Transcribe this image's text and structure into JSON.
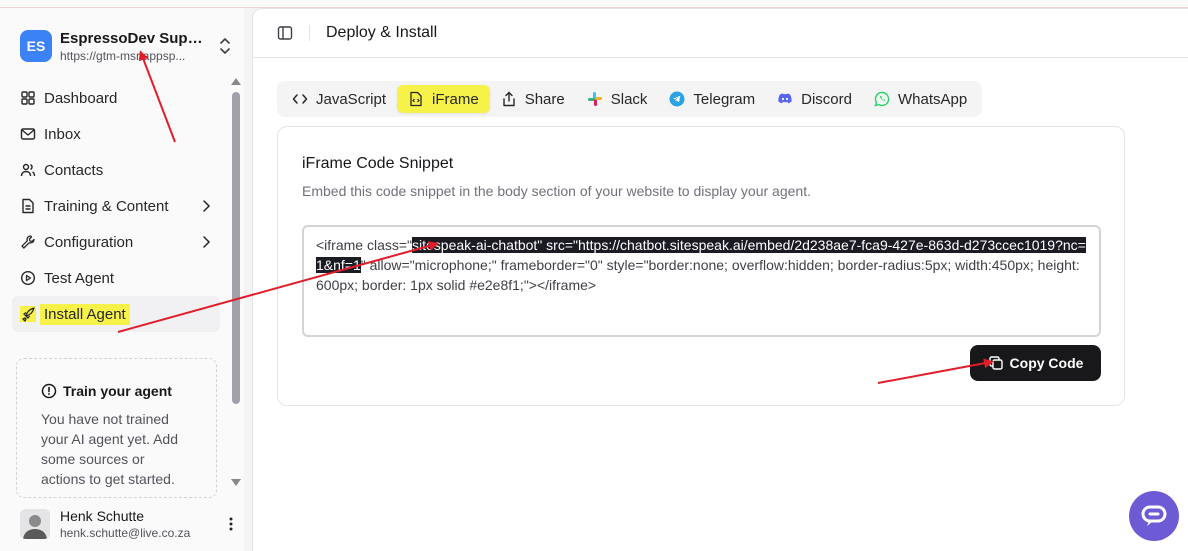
{
  "workspace": {
    "initials": "ES",
    "name": "EspressoDev Supp...",
    "url": "https://gtm-msr.appsp..."
  },
  "nav": [
    {
      "label": "Dashboard",
      "icon": "layout-grid-icon",
      "has_arrow": false
    },
    {
      "label": "Inbox",
      "icon": "mail-icon",
      "has_arrow": false
    },
    {
      "label": "Contacts",
      "icon": "users-icon",
      "has_arrow": false
    },
    {
      "label": "Training & Content",
      "icon": "file-text-icon",
      "has_arrow": true
    },
    {
      "label": "Configuration",
      "icon": "wrench-icon",
      "has_arrow": true
    },
    {
      "label": "Test Agent",
      "icon": "play-circle-icon",
      "has_arrow": false
    },
    {
      "label": "Install Agent",
      "icon": "rocket-icon",
      "has_arrow": false,
      "active": true
    }
  ],
  "train_card": {
    "title": "Train your agent",
    "body": "You have not trained your AI agent yet. Add some sources or actions to get started."
  },
  "user": {
    "name": "Henk Schutte",
    "email": "henk.schutte@live.co.za"
  },
  "header": {
    "title": "Deploy & Install"
  },
  "tabs": [
    {
      "label": "JavaScript",
      "icon": "code-icon"
    },
    {
      "label": "iFrame",
      "icon": "iframe-icon",
      "active": true
    },
    {
      "label": "Share",
      "icon": "share-icon"
    },
    {
      "label": "Slack",
      "icon": "slack-icon"
    },
    {
      "label": "Telegram",
      "icon": "telegram-icon"
    },
    {
      "label": "Discord",
      "icon": "discord-icon"
    },
    {
      "label": "WhatsApp",
      "icon": "whatsapp-icon"
    }
  ],
  "snippet_card": {
    "title": "iFrame Code Snippet",
    "description": "Embed this code snippet in the body section of your website to display your agent.",
    "code_before": "<iframe class=\"",
    "code_selected": "sitespeak-ai-chatbot\" src=\"https://chatbot.sitespeak.ai/embed/2d238ae7-fca9-427e-863d-d273ccec1019?nc=1&nf=1",
    "code_after": "\" allow=\"microphone;\" frameborder=\"0\" style=\"border:none; overflow:hidden; border-radius:5px; width:450px; height:600px; border: 1px solid #e2e8f1;\"></iframe>",
    "copy_label": "Copy Code"
  },
  "colors": {
    "highlight": "#f7f24a",
    "annotation_arrow": "#e11d2a",
    "workspace_avatar": "#3b82f6",
    "chat_bubble": "#6d5bd6"
  }
}
